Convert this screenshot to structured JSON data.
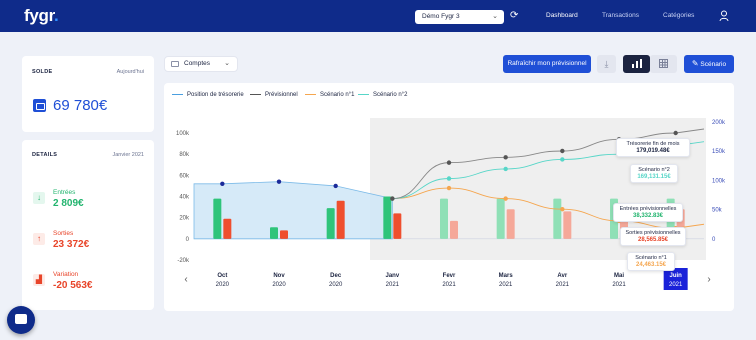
{
  "header": {
    "logo": "fygr",
    "account_selector": "Démo Fygr 3",
    "nav": [
      "Dashboard",
      "Transactions",
      "Catégories"
    ]
  },
  "balance_card": {
    "title": "SOLDE",
    "date": "Aujourd'hui",
    "value": "69 780€"
  },
  "details_card": {
    "title": "DETAILS",
    "month": "Janvier 2021",
    "stats": [
      {
        "label": "Entrées",
        "value": "2 809€",
        "color": "#22b46e",
        "icon": "arrow-down-icon"
      },
      {
        "label": "Sorties",
        "value": "23 372€",
        "color": "#e8452a",
        "icon": "arrow-up-icon"
      },
      {
        "label": "Variation",
        "value": "-20 563€",
        "color": "#e8452a",
        "icon": "bar-chart-icon"
      }
    ]
  },
  "toolbar": {
    "accounts_select": "Comptes",
    "refresh_forecast": "Rafraîchir mon prévisionnel",
    "scenario_button": "Scénario"
  },
  "chart_data": {
    "type": "bar",
    "legend": [
      {
        "name": "Position de trésorerie",
        "color": "#4a9fe0"
      },
      {
        "name": "Prévisionnel",
        "color": "#555555"
      },
      {
        "name": "Scénario n°1",
        "color": "#f5a64f"
      },
      {
        "name": "Scénario n°2",
        "color": "#57d6c8"
      }
    ],
    "categories": [
      "Oct\n2020",
      "Nov\n2020",
      "Dec\n2020",
      "Janv\n2021",
      "Fevr\n2021",
      "Mars\n2021",
      "Avr\n2021",
      "Mai\n2021",
      "Juin\n2021"
    ],
    "month_labels": [
      "Oct",
      "Nov",
      "Dec",
      "Janv",
      "Fevr",
      "Mars",
      "Avr",
      "Mai",
      "Juin"
    ],
    "year_labels": [
      "2020",
      "2020",
      "2020",
      "2021",
      "2021",
      "2021",
      "2021",
      "2021",
      "2021"
    ],
    "left_axis_ticks": [
      "100k",
      "80k",
      "60k",
      "40k",
      "20k",
      "0",
      "-20k"
    ],
    "right_axis_ticks": [
      "200k",
      "150k",
      "100k",
      "50k",
      "0"
    ],
    "ylim_left": [
      -20000,
      100000
    ],
    "ylim_right": [
      0,
      200000
    ],
    "entrees": [
      38000,
      11000,
      29000,
      40000,
      38000,
      38000,
      38000,
      38000,
      38000
    ],
    "sorties": [
      19000,
      8000,
      36000,
      24000,
      17000,
      28000,
      26000,
      22000,
      28000
    ],
    "position_tresorerie": [
      52000,
      54000,
      50000,
      38000
    ],
    "previsionnel": [
      38000,
      72000,
      77000,
      83000,
      94000,
      100000
    ],
    "scenario1": [
      38000,
      48000,
      38000,
      28000,
      17000,
      10000
    ],
    "scenario2": [
      38000,
      57000,
      66000,
      75000,
      80000,
      88000
    ],
    "selected_month": "Juin",
    "tooltips": [
      {
        "label": "Trésorerie fin de mois",
        "value": "179,019.48€",
        "color": "#1b2340"
      },
      {
        "label": "Scénario n°2",
        "value": "169,131.15€",
        "color": "#57d6c8"
      },
      {
        "label": "Entrées prévisionnelles",
        "value": "38,332.83€",
        "color": "#22b46e"
      },
      {
        "label": "Sorties prévisionnelles",
        "value": "28,565.85€",
        "color": "#e8452a"
      },
      {
        "label": "Scénario n°1",
        "value": "24,463.15€",
        "color": "#f5a64f"
      }
    ]
  }
}
